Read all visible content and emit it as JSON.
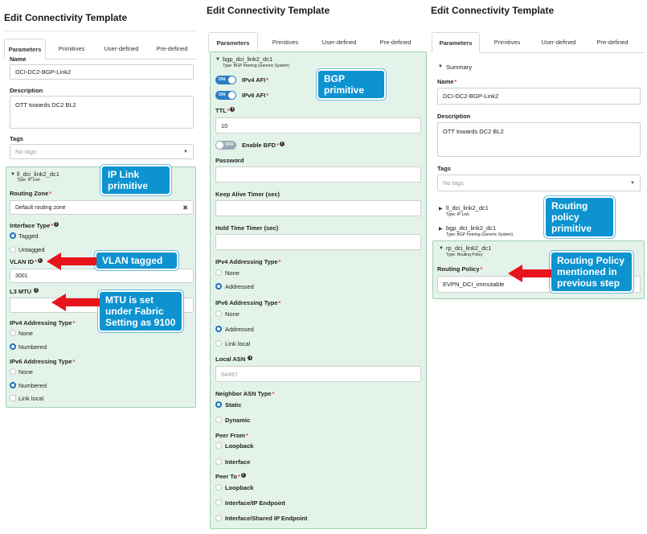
{
  "panel1": {
    "title": "Edit Connectivity Template",
    "tabs": [
      "Parameters",
      "Primitives",
      "User-defined",
      "Pre-defined"
    ],
    "name_label": "Name",
    "name_value": "DCI-DC2-BGP-Link2",
    "description_label": "Description",
    "description_value": "OTT towards DC2 BL2",
    "tags_label": "Tags",
    "tags_placeholder": "No tags",
    "block_title": "ll_dci_link2_dc1",
    "block_type": "Type: IP Link",
    "routing_zone_label": "Routing Zone",
    "routing_zone_value": "Default routing zone",
    "interface_type_label": "Interface Type",
    "tagged": "Tagged",
    "untagged": "Untagged",
    "vlan_label": "VLAN ID",
    "vlan_value": "3001",
    "l3mtu_label": "L3 MTU",
    "ipv4_addr_label": "IPv4 Addressing Type",
    "none": "None",
    "numbered": "Numbered",
    "ipv6_addr_label": "IPv6 Addressing Type",
    "link_local": "Link local"
  },
  "panel2": {
    "title": "Edit Connectivity Template",
    "tabs": [
      "Parameters",
      "Primitives",
      "User-defined",
      "Pre-defined"
    ],
    "block_title": "bgp_dci_link2_dc1",
    "block_type": "Type: BGP Peering (Generic System)",
    "toggle_on": "ON",
    "toggle_off": "OFF",
    "ipv4_afi": "IPv4 AFI",
    "ipv6_afi": "IPv6 AFI",
    "ttl_label": "TTL",
    "ttl_value": "10",
    "enable_bfd": "Enable BFD",
    "password_label": "Password",
    "keepalive_label": "Keep Alive Timer (sec)",
    "holdtime_label": "Hold Time Timer (sec)",
    "ipv4_addr_label": "IPv4 Addressing Type",
    "none": "None",
    "addressed": "Addressed",
    "ipv6_addr_label": "IPv6 Addressing Type",
    "link_local": "Link local",
    "local_asn_label": "Local ASN",
    "local_asn_placeholder": "64497",
    "neighbor_asn_label": "Neighbor ASN Type",
    "static": "Static",
    "dynamic": "Dynamic",
    "peer_from_label": "Peer From",
    "loopback": "Loopback",
    "interface": "Interface",
    "peer_to_label": "Peer To",
    "interface_ip_endpoint": "Interface/IP Endpoint",
    "interface_shared_ip_endpoint": "Interface/Shared IP Endpoint"
  },
  "panel3": {
    "title": "Edit Connectivity Template",
    "tabs": [
      "Parameters",
      "Primitives",
      "User-defined",
      "Pre-defined"
    ],
    "summary": "Summary",
    "name_label": "Name",
    "name_value": "DCI-DC2-BGP-Link2",
    "description_label": "Description",
    "description_value": "OTT towards DC2 BL2",
    "tags_label": "Tags",
    "tags_placeholder": "No tags",
    "item1_title": "ll_dci_link2_dc1",
    "item1_type": "Type: IP Link",
    "item2_title": "bgp_dci_link2_dc1",
    "item2_type": "Type: BGP Peering (Generic System)",
    "block_title": "rp_dci_link2_dc1",
    "block_type": "Type: Routing Policy",
    "routing_policy_label": "Routing Policy",
    "routing_policy_value": "EVPN_DCI_immutable"
  },
  "callouts": {
    "ip_link": "IP Link primitive",
    "vlan_tagged": "VLAN tagged",
    "mtu": "MTU is set under Fabric Setting as 9100",
    "bgp": "BGP primitive",
    "routing_policy_primitive": "Routing policy primitive",
    "routing_policy_mentioned": "Routing Policy mentioned in previous step"
  },
  "colors": {
    "callout_bg": "#0c93d0",
    "arrow_red": "#e8141c",
    "block_green": "#e4f3ea",
    "toggle_blue": "#2a7ec3"
  }
}
